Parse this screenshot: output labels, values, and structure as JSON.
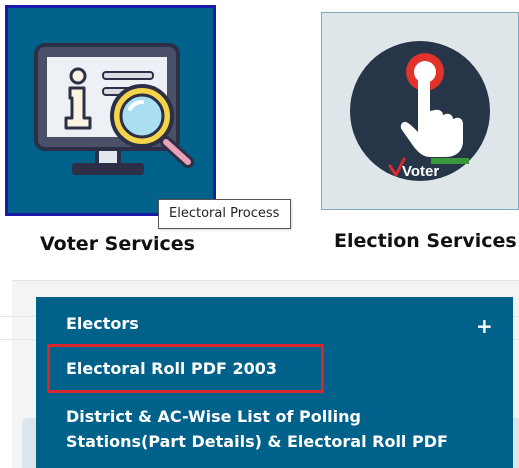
{
  "tiles": {
    "voter_services": {
      "caption": "Voter Services",
      "background": "#00628a",
      "border_color": "#1a1aa8",
      "icon": "monitor-info-magnifier-icon"
    },
    "election_services": {
      "caption": "Election Services",
      "background": "#dfe6ea",
      "icon": "voter-touch-icon",
      "icon_text": "Voter"
    }
  },
  "tooltip": {
    "text": "Electoral Process"
  },
  "menu": {
    "background": "#00628a",
    "items": [
      {
        "label": "Electors",
        "expand_symbol": "+"
      },
      {
        "label": "Electoral Roll PDF 2003"
      },
      {
        "label": "District & AC-Wise List of Polling Stations(Part Details) & Electoral Roll PDF"
      }
    ],
    "highlight_color": "#d7262e"
  }
}
